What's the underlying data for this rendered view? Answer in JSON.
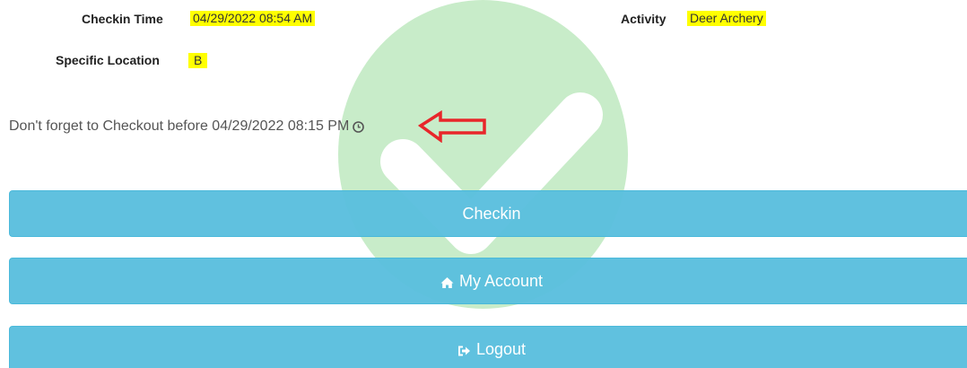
{
  "info": {
    "checkin_time_label": "Checkin Time",
    "checkin_time_value": "04/29/2022 08:54 AM",
    "activity_label": "Activity",
    "activity_value": "Deer Archery",
    "specific_location_label": "Specific Location",
    "specific_location_value": "B"
  },
  "reminder": {
    "text": "Don't forget to Checkout before 04/29/2022 08:15 PM",
    "icon": "clock-icon"
  },
  "annotation": {
    "icon": "left-arrow-annotation",
    "color": "#e8262a"
  },
  "buttons": {
    "checkin_label": "Checkin",
    "my_account_label": "My Account",
    "my_account_icon": "home-icon",
    "logout_label": "Logout",
    "logout_icon": "sign-out-icon"
  },
  "colors": {
    "button_bg": "#5bc0de",
    "highlight": "#ffff00",
    "watermark": "#c8ecc9"
  }
}
